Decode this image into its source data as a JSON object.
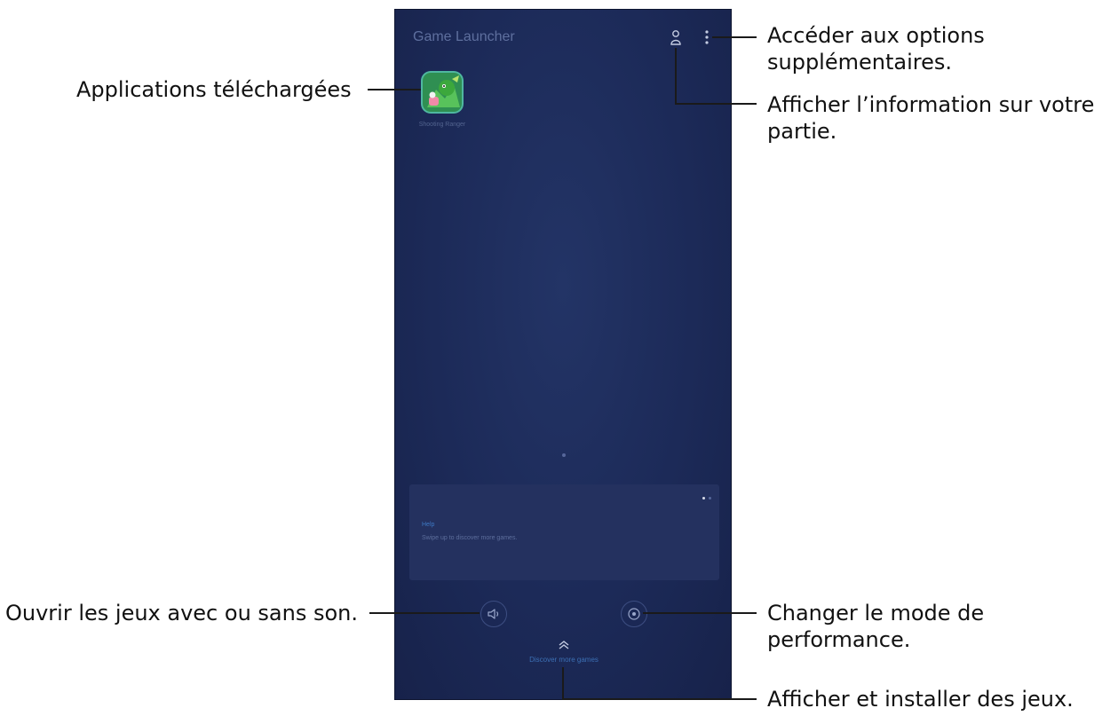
{
  "screen": {
    "app_title": "Game Launcher",
    "game": {
      "icon": "game-app-icon",
      "name": "Shooting Ranger"
    },
    "tip_card": {
      "title": "Help",
      "body": "Swipe up to discover more games."
    },
    "sound_button": {
      "icon": "speaker-icon"
    },
    "performance_button": {
      "icon": "performance-mode-icon"
    },
    "more_games": {
      "icon": "chevron-up-icon",
      "label": "Discover more games"
    },
    "header_icons": [
      "profile-icon",
      "more-options-icon"
    ]
  },
  "callouts": {
    "more_options": "Accéder aux options\nsupplémentaires.",
    "game_info": "Afficher l’information sur votre\npartie.",
    "downloaded_apps": "Applications téléchargées",
    "sound": "Ouvrir les jeux avec ou sans son.",
    "performance": "Changer le mode de\nperformance.",
    "install_games": "Afficher et installer des jeux."
  },
  "colors": {
    "screen_background": "#1c2a58",
    "tip_card_background": "#24315f",
    "accent_blue": "#3c6fb4",
    "callout_line": "#1a1a1a"
  }
}
